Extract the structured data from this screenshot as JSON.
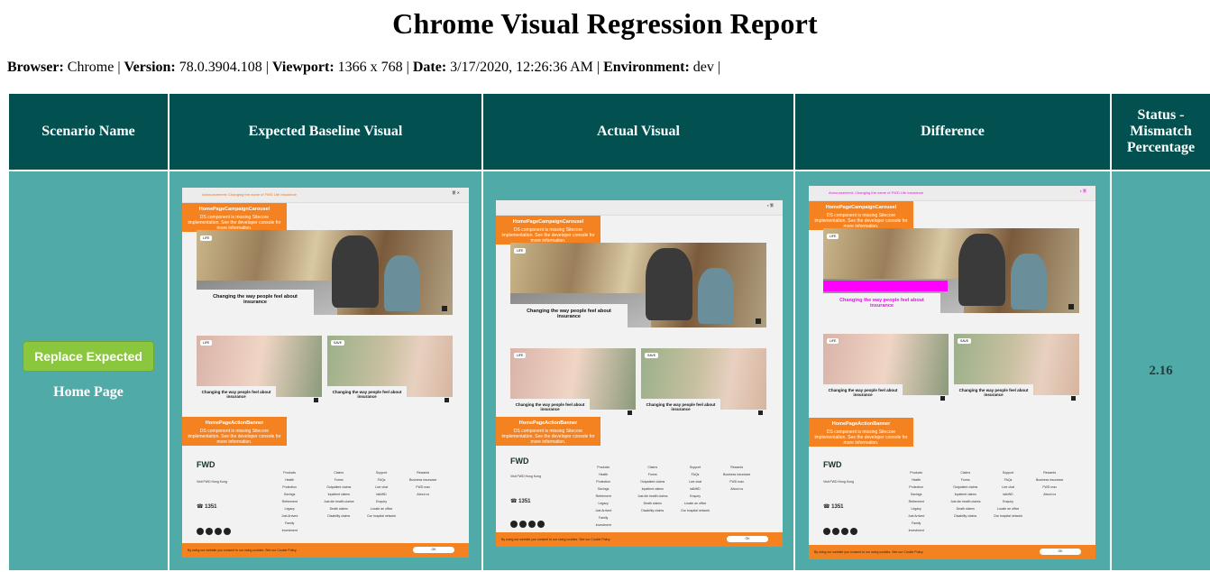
{
  "report": {
    "title": "Chrome Visual Regression Report",
    "meta": {
      "browser_label": "Browser:",
      "browser": "Chrome",
      "version_label": "Version:",
      "version": "78.0.3904.108",
      "viewport_label": "Viewport:",
      "viewport": "1366 x 768",
      "date_label": "Date:",
      "date": "3/17/2020, 12:26:36 AM",
      "environment_label": "Environment:",
      "environment": "dev",
      "separator": "|"
    }
  },
  "table": {
    "headers": [
      "Scenario Name",
      "Expected Baseline Visual",
      "Actual Visual",
      "Difference",
      "Status - Mismatch Percentage"
    ],
    "rows": [
      {
        "replace_button": "Replace Expected",
        "scenario": "Home Page",
        "mismatch": "2.16"
      }
    ]
  },
  "screenshot": {
    "announcement": "Announcement: Changing the name of FWD Life Insurance",
    "carousel_banner_title": "HomePageCampaignCarousel",
    "action_banner_title": "HomePageActionBanner",
    "banner_text": "DS component is missing Sitecore implementation. See the developer console for more information.",
    "tag": "LIFE",
    "tag2": "SAVE",
    "hero_text": "Changing the way people feel about insurance",
    "tile_text": "Changing the way people feel about insurance",
    "logo": "FWD",
    "visit": "Visit FWD Hong Kong",
    "phone": "1351",
    "footer_cols": [
      [
        "Products",
        "Health",
        "Protection",
        "Savings",
        "Retirement",
        "Legacy",
        "Just Arrived",
        "Family",
        "Investment"
      ],
      [
        "Claims",
        "Forms",
        "Outpatient claims",
        "Inpatient claims",
        "Just die health claims",
        "Death claims",
        "Disability claims"
      ],
      [
        "Support",
        "FAQs",
        "Live chat",
        "talkWD",
        "Enquiry",
        "Locate an office",
        "Our hospital network"
      ],
      [
        "Rewards",
        "Business insurance",
        "FWD max",
        "About us"
      ]
    ],
    "cookie_text": "By using our website you consent to our using cookies. See our Cookie Policy",
    "ok": "OK"
  },
  "colors": {
    "header_bg": "#025050",
    "row_bg": "#50aaa8",
    "button_bg": "#8bc63f",
    "fwd_orange": "#f58220",
    "diff_highlight": "#ff00ff"
  }
}
